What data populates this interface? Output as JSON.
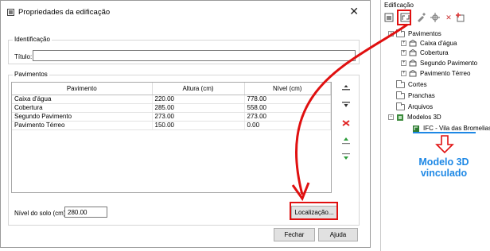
{
  "dialog": {
    "title": "Propriedades da edificação",
    "close_glyph": "✕",
    "identification": {
      "legend": "Identificação",
      "title_label": "Título:",
      "title_value": ""
    },
    "floors": {
      "legend": "Pavimentos",
      "columns": [
        "Pavimento",
        "Altura (cm)",
        "Nível (cm)"
      ],
      "rows": [
        [
          "Caixa d'água",
          "220.00",
          "778.00"
        ],
        [
          "Cobertura",
          "285.00",
          "558.00"
        ],
        [
          "Segundo Pavimento",
          "273.00",
          "273.00"
        ],
        [
          "Pavimento Térreo",
          "150.00",
          "0.00"
        ]
      ],
      "side_icons": [
        "insert-above-icon",
        "insert-below-icon",
        "delete-row-icon",
        "move-up-icon",
        "move-down-icon"
      ]
    },
    "ground_level_label": "Nível do solo (cm):",
    "ground_level_value": "280.00",
    "location_button": "Localização...",
    "close_button": "Fechar",
    "help_button": "Ajuda"
  },
  "panel": {
    "title": "Edificação",
    "toolbar_icons": [
      "building-properties-icon",
      "link-icon",
      "edit-icon",
      "delete-icon",
      "add-icon"
    ],
    "tree": {
      "pavimentos": "Pavimentos",
      "floors": [
        "Caixa d'água",
        "Cobertura",
        "Segundo Pavimento",
        "Pavimento Térreo"
      ],
      "cortes": "Cortes",
      "pranchas": "Pranchas",
      "arquivos": "Arquivos",
      "modelos": "Modelos 3D",
      "ifc_item": "IFC - Vila das Bromelias"
    }
  },
  "annotation": {
    "text": "Modelo 3D\nvinculado",
    "color": "#1e88e5",
    "highlight_color": "#e01010"
  }
}
